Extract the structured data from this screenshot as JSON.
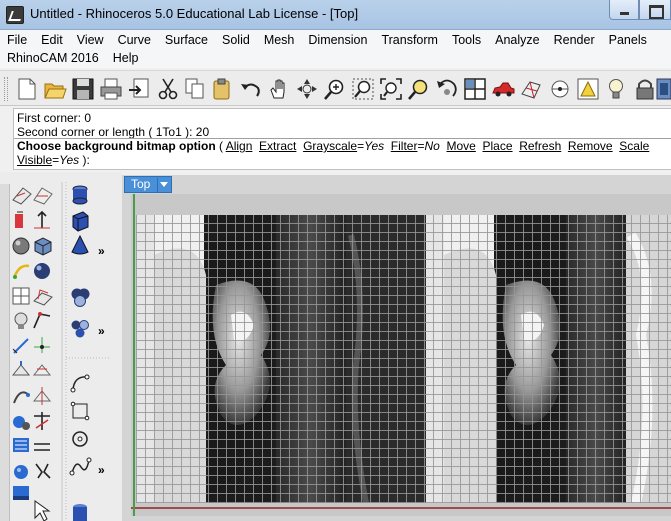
{
  "window": {
    "title": "Untitled - Rhinoceros 5.0 Educational Lab License - [Top]"
  },
  "menu": {
    "row1": [
      "File",
      "Edit",
      "View",
      "Curve",
      "Surface",
      "Solid",
      "Mesh",
      "Dimension",
      "Transform",
      "Tools",
      "Analyze",
      "Render",
      "Panels"
    ],
    "row2": [
      "RhinoCAM 2016",
      "Help"
    ]
  },
  "toolbar": {
    "icons": [
      "new-icon",
      "open-icon",
      "save-icon",
      "print-icon",
      "import-icon",
      "cut-icon",
      "copy-icon",
      "paste-icon",
      "undo-icon",
      "pan-hand-icon",
      "rotate-view-icon",
      "zoom-dynamic-icon",
      "zoom-window-icon",
      "zoom-extents-icon",
      "zoom-selected-icon",
      "rotate-icon",
      "four-viewports-icon",
      "car-render-icon",
      "surface-icon",
      "snap-icon",
      "object-snap-icon",
      "light-bulb-icon",
      "lock-icon",
      "more-icon"
    ]
  },
  "command": {
    "line1": "First corner: 0",
    "line2": "Second corner or length ( 1To1 ): 20",
    "prompt": "Choose background bitmap option",
    "open_paren": " ( ",
    "options": {
      "align": "Align",
      "extract": "Extract",
      "grayscale": "Grayscale",
      "grayscale_value": "Yes",
      "filter": "Filter",
      "filter_value": "No",
      "move": "Move",
      "place": "Place",
      "refresh": "Refresh",
      "remove": "Remove",
      "scale": "Scale",
      "visible": "Visible",
      "visible_value": "Yes"
    },
    "equals": "=",
    "close": " ):"
  },
  "viewport": {
    "tab_label": "Top"
  },
  "colors": {
    "titlebar": "#b9d1ea",
    "viewport_tab": "#4a90d9",
    "x_axis": "#a24a4a",
    "y_axis": "#4c9a4c"
  }
}
